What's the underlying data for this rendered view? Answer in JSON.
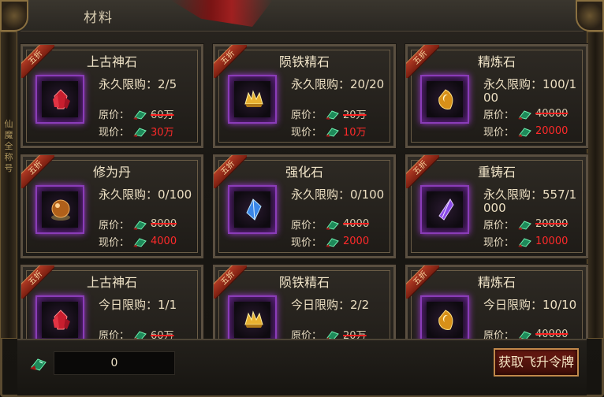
{
  "window": {
    "title": "材料"
  },
  "side_rail": {
    "glyphs": "仙 魔 全 称 号"
  },
  "colors": {
    "purple_glow": "#9d3ad0",
    "price_red": "#ff2a2a",
    "strike_red": "#ff2020",
    "gold_border": "#c0884a"
  },
  "labels": {
    "discount": "五折",
    "original_price": "原价：",
    "current_price": "现价："
  },
  "cards": [
    {
      "name": "上古神石",
      "limit": "永久限购：2/5",
      "original": "60万",
      "current": "30万",
      "icon": "red-crystal-icon",
      "has_discount": true
    },
    {
      "name": "陨铁精石",
      "limit": "永久限购：20/20",
      "original": "20万",
      "current": "10万",
      "icon": "gold-crystal-icon",
      "has_discount": true
    },
    {
      "name": "精炼石",
      "limit": "永久限购：100/100",
      "original": "40000",
      "current": "20000",
      "icon": "moon-stone-icon",
      "has_discount": true
    },
    {
      "name": "修为丹",
      "limit": "永久限购：0/100",
      "original": "8000",
      "current": "4000",
      "icon": "orb-icon",
      "has_discount": true
    },
    {
      "name": "强化石",
      "limit": "永久限购：0/100",
      "original": "4000",
      "current": "2000",
      "icon": "blue-crystal-icon",
      "has_discount": true
    },
    {
      "name": "重铸石",
      "limit": "永久限购：557/1000",
      "original": "20000",
      "current": "10000",
      "icon": "purple-crystal-icon",
      "has_discount": true
    },
    {
      "name": "上古神石",
      "limit": "今日限购：1/1",
      "original": "60万",
      "current": "",
      "icon": "red-crystal-icon",
      "has_discount": true
    },
    {
      "name": "陨铁精石",
      "limit": "今日限购：2/2",
      "original": "20万",
      "current": "",
      "icon": "gold-crystal-icon",
      "has_discount": true
    },
    {
      "name": "精炼石",
      "limit": "今日限购：10/10",
      "original": "40000",
      "current": "",
      "icon": "moon-stone-icon",
      "has_discount": true
    }
  ],
  "footer": {
    "amount": "0",
    "obtain_button": "获取飞升令牌",
    "currency_icon": "jade-token-icon"
  }
}
